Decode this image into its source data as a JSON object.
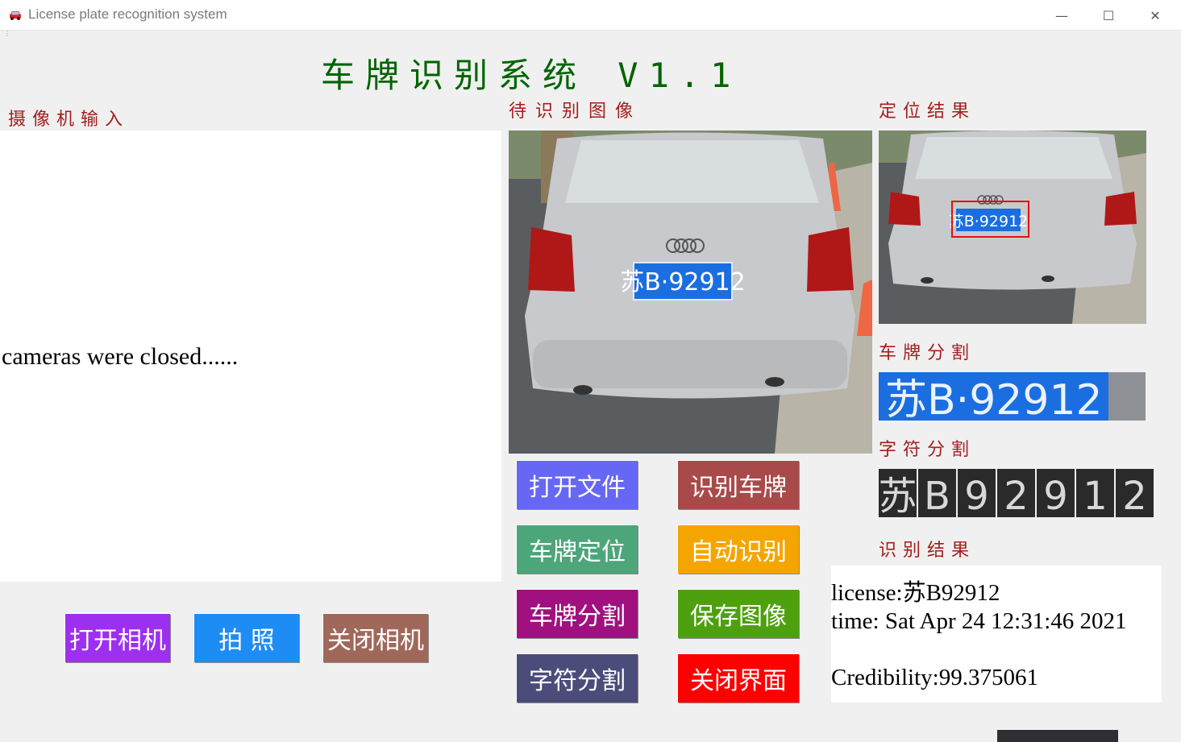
{
  "window": {
    "title": "License plate recognition system",
    "minimize_glyph": "—",
    "maximize_glyph": "☐",
    "close_glyph": "✕"
  },
  "header": {
    "title": "车牌识别系统 V1.1"
  },
  "labels": {
    "camera_input": "摄像机输入",
    "image_to_recognize": "待识别图像",
    "location_result": "定位结果",
    "plate_segmentation": "车牌分割",
    "char_segmentation": "字符分割",
    "recognition_result": "识别结果"
  },
  "camera": {
    "status": "cameras were closed......"
  },
  "plate": {
    "text": "苏B·92912",
    "chars": [
      "苏",
      "B",
      "9",
      "2",
      "9",
      "1",
      "2"
    ]
  },
  "buttons": {
    "open_file": "打开文件",
    "recognize_plate": "识别车牌",
    "locate_plate": "车牌定位",
    "auto_recognize": "自动识别",
    "segment_plate": "车牌分割",
    "save_image": "保存图像",
    "segment_chars": "字符分割",
    "close_ui": "关闭界面",
    "open_camera": "打开相机",
    "take_photo": "拍 照",
    "close_camera": "关闭相机"
  },
  "colors": {
    "open_file": "#6767f5",
    "recognize_plate": "#a94a4a",
    "locate_plate": "#4da57a",
    "auto_recognize": "#f5a500",
    "segment_plate": "#a0117f",
    "save_image": "#4ea00f",
    "segment_chars": "#4c4c7a",
    "close_ui": "#ff0000",
    "open_camera": "#9d2ff0",
    "take_photo": "#1e8cf5",
    "close_camera": "#a0685a",
    "title": "#006400",
    "label": "#a51d1d",
    "plate_blue": "#1a6ee0"
  },
  "result": {
    "license": "license:苏B92912",
    "time": "time: Sat Apr 24 12:31:46 2021",
    "credibility": "Credibility:99.375061"
  }
}
